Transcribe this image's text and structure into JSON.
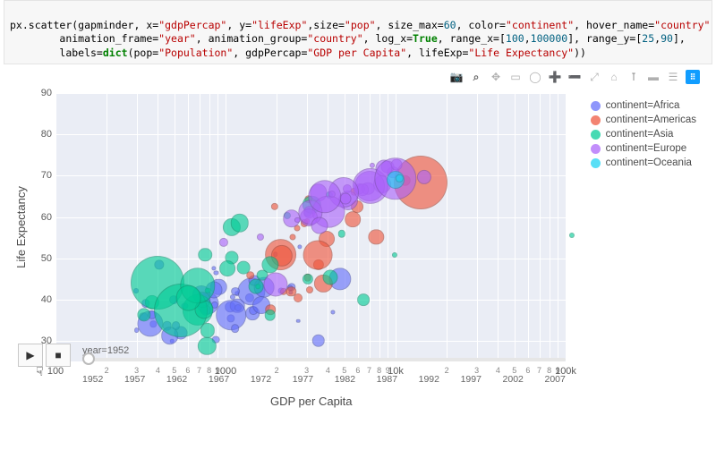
{
  "code": {
    "lines": [
      "px.scatter(gapminder, x=\"gdpPercap\", y=\"lifeExp\",size=\"pop\", size_max=60, color=\"continent\", hover_name=\"country\",",
      "        animation_frame=\"year\", animation_group=\"country\", log_x=True, range_x=[100,100000], range_y=[25,90],",
      "        labels=dict(pop=\"Population\", gdpPercap=\"GDP per Capita\", lifeExp=\"Life Expectancy\"))"
    ]
  },
  "toolbar": {
    "icons": [
      "camera-icon",
      "zoom-icon",
      "pan-icon",
      "box-select-icon",
      "lasso-icon",
      "zoom-in-icon",
      "zoom-out-icon",
      "autoscale-icon",
      "reset-icon",
      "spike-icon",
      "hover-icon",
      "hover-compare-icon",
      "plotly-logo"
    ]
  },
  "legend": {
    "items": [
      {
        "label": "continent=Africa",
        "color": "#636efa"
      },
      {
        "label": "continent=Americas",
        "color": "#ef553b"
      },
      {
        "label": "continent=Asia",
        "color": "#00cc96"
      },
      {
        "label": "continent=Europe",
        "color": "#ab63fa"
      },
      {
        "label": "continent=Oceania",
        "color": "#19d3f3"
      }
    ]
  },
  "axes": {
    "xlabel": "GDP per Capita",
    "ylabel": "Life Expectancy",
    "yticks": [
      "30",
      "40",
      "50",
      "60",
      "70",
      "80",
      "90"
    ],
    "xticks_major": [
      "100",
      "1000",
      "10k",
      "100k"
    ]
  },
  "animation": {
    "label": "year=1952",
    "play": "▶",
    "stop": "■",
    "years": [
      "1952",
      "1957",
      "1962",
      "1967",
      "1972",
      "1977",
      "1982",
      "1987",
      "1992",
      "1997",
      "2002",
      "2007"
    ]
  },
  "chart_data": {
    "type": "scatter",
    "title": "",
    "xlabel": "GDP per Capita",
    "ylabel": "Life Expectancy",
    "xlim": [
      100,
      100000
    ],
    "ylim": [
      25,
      90
    ],
    "log_x": true,
    "size_field": "pop",
    "size_max": 60,
    "animation_frame": "year",
    "current_frame": 1952,
    "series": [
      {
        "name": "Africa",
        "color": "#636efa",
        "points": [
          {
            "x": 2449,
            "y": 43.1,
            "size": 9.3
          },
          {
            "x": 3521,
            "y": 30.0,
            "size": 14.5
          },
          {
            "x": 1063,
            "y": 38.2,
            "size": 11.6
          },
          {
            "x": 851,
            "y": 47.6,
            "size": 5.2
          },
          {
            "x": 543,
            "y": 32.0,
            "size": 15.0
          },
          {
            "x": 339,
            "y": 39.0,
            "size": 9.6
          },
          {
            "x": 1173,
            "y": 38.5,
            "size": 16.6
          },
          {
            "x": 1071,
            "y": 35.5,
            "size": 9.2
          },
          {
            "x": 1179,
            "y": 38.1,
            "size": 8.1
          },
          {
            "x": 1103,
            "y": 40.7,
            "size": 6.1
          },
          {
            "x": 781,
            "y": 39.1,
            "size": 25.0
          },
          {
            "x": 2126,
            "y": 42.1,
            "size": 7.0
          },
          {
            "x": 1389,
            "y": 40.5,
            "size": 10.2
          },
          {
            "x": 2670,
            "y": 34.8,
            "size": 4.6
          },
          {
            "x": 1419,
            "y": 41.9,
            "size": 31.2
          },
          {
            "x": 376,
            "y": 34.1,
            "size": 7.5
          },
          {
            "x": 329,
            "y": 35.9,
            "size": 9.4
          },
          {
            "x": 362,
            "y": 34.1,
            "size": 29.2
          },
          {
            "x": 4293,
            "y": 37.0,
            "size": 5.1
          },
          {
            "x": 485,
            "y": 30.0,
            "size": 4.6
          },
          {
            "x": 912,
            "y": 43.1,
            "size": 18.5
          },
          {
            "x": 511,
            "y": 33.6,
            "size": 9.9
          },
          {
            "x": 300,
            "y": 32.5,
            "size": 5.8
          },
          {
            "x": 854,
            "y": 42.3,
            "size": 19.0
          },
          {
            "x": 299,
            "y": 42.1,
            "size": 5.9
          },
          {
            "x": 576,
            "y": 38.5,
            "size": 7.1
          },
          {
            "x": 2387,
            "y": 42.7,
            "size": 7.1
          },
          {
            "x": 1443,
            "y": 36.7,
            "size": 15.7
          },
          {
            "x": 369,
            "y": 36.3,
            "size": 10.4
          },
          {
            "x": 453,
            "y": 33.7,
            "size": 10.6
          },
          {
            "x": 744,
            "y": 40.5,
            "size": 8.0
          },
          {
            "x": 1968,
            "y": 51.0,
            "size": 5.5
          },
          {
            "x": 1688,
            "y": 42.9,
            "size": 22.8
          },
          {
            "x": 469,
            "y": 31.3,
            "size": 19.6
          },
          {
            "x": 2424,
            "y": 41.7,
            "size": 5.4
          },
          {
            "x": 762,
            "y": 37.4,
            "size": 12.4
          },
          {
            "x": 1077,
            "y": 36.3,
            "size": 33.6
          },
          {
            "x": 2719,
            "y": 52.7,
            "size": 5.2
          },
          {
            "x": 494,
            "y": 40.0,
            "size": 9.8
          },
          {
            "x": 880,
            "y": 46.5,
            "size": 5.1
          },
          {
            "x": 1451,
            "y": 37.3,
            "size": 9.8
          },
          {
            "x": 879,
            "y": 30.3,
            "size": 8.7
          },
          {
            "x": 1136,
            "y": 33.0,
            "size": 9.7
          },
          {
            "x": 4725,
            "y": 45.0,
            "size": 25.3
          },
          {
            "x": 1616,
            "y": 38.6,
            "size": 20.0
          },
          {
            "x": 1169,
            "y": 41.4,
            "size": 5.5
          },
          {
            "x": 717,
            "y": 41.2,
            "size": 20.1
          },
          {
            "x": 860,
            "y": 38.6,
            "size": 8.2
          },
          {
            "x": 1468,
            "y": 44.6,
            "size": 12.9
          },
          {
            "x": 735,
            "y": 40.0,
            "size": 17.7
          },
          {
            "x": 1147,
            "y": 42.0,
            "size": 9.8
          },
          {
            "x": 407,
            "y": 48.5,
            "size": 11.3
          }
        ]
      },
      {
        "name": "Americas",
        "color": "#ef553b",
        "points": [
          {
            "x": 5911,
            "y": 62.5,
            "size": 13.9
          },
          {
            "x": 2677,
            "y": 40.4,
            "size": 10.0
          },
          {
            "x": 2109,
            "y": 50.9,
            "size": 35.8
          },
          {
            "x": 11367,
            "y": 68.8,
            "size": 12.5
          },
          {
            "x": 3940,
            "y": 54.7,
            "size": 17.9
          },
          {
            "x": 2144,
            "y": 50.6,
            "size": 24.3
          },
          {
            "x": 2627,
            "y": 57.2,
            "size": 7.0
          },
          {
            "x": 5587,
            "y": 59.4,
            "size": 17.7
          },
          {
            "x": 1398,
            "y": 45.9,
            "size": 9.6
          },
          {
            "x": 3522,
            "y": 48.4,
            "size": 12.2
          },
          {
            "x": 3048,
            "y": 45.3,
            "size": 8.5
          },
          {
            "x": 2428,
            "y": 42.0,
            "size": 11.4
          },
          {
            "x": 1840,
            "y": 37.6,
            "size": 11.6
          },
          {
            "x": 2195,
            "y": 41.9,
            "size": 8.3
          },
          {
            "x": 2899,
            "y": 58.5,
            "size": 8.1
          },
          {
            "x": 3478,
            "y": 50.8,
            "size": 32.9
          },
          {
            "x": 3112,
            "y": 42.3,
            "size": 8.0
          },
          {
            "x": 2480,
            "y": 55.2,
            "size": 7.0
          },
          {
            "x": 1952,
            "y": 62.6,
            "size": 8.3
          },
          {
            "x": 3759,
            "y": 43.9,
            "size": 20.3
          },
          {
            "x": 3082,
            "y": 64.3,
            "size": 9.5
          },
          {
            "x": 3023,
            "y": 59.1,
            "size": 5.9
          },
          {
            "x": 13990,
            "y": 68.4,
            "size": 60.0
          },
          {
            "x": 5717,
            "y": 66.1,
            "size": 8.5
          },
          {
            "x": 7690,
            "y": 55.1,
            "size": 17.3
          }
        ]
      },
      {
        "name": "Asia",
        "color": "#00cc96",
        "points": [
          {
            "x": 779,
            "y": 28.8,
            "size": 20.4
          },
          {
            "x": 9867,
            "y": 50.9,
            "size": 6.1
          },
          {
            "x": 684,
            "y": 37.5,
            "size": 34.2
          },
          {
            "x": 368,
            "y": 39.4,
            "size": 16.3
          },
          {
            "x": 400,
            "y": 44.0,
            "size": 60.0
          },
          {
            "x": 3054,
            "y": 61.0,
            "size": 9.3
          },
          {
            "x": 547,
            "y": 37.4,
            "size": 60.0
          },
          {
            "x": 750,
            "y": 37.5,
            "size": 21.1
          },
          {
            "x": 3035,
            "y": 44.9,
            "size": 12.2
          },
          {
            "x": 4129,
            "y": 45.3,
            "size": 17.0
          },
          {
            "x": 4086,
            "y": 65.4,
            "size": 8.2
          },
          {
            "x": 3217,
            "y": 63.0,
            "size": 20.4
          },
          {
            "x": 1547,
            "y": 43.2,
            "size": 5.6
          },
          {
            "x": 1088,
            "y": 50.1,
            "size": 15.1
          },
          {
            "x": 1030,
            "y": 47.5,
            "size": 17.8
          },
          {
            "x": 108382,
            "y": 55.6,
            "size": 6.1
          },
          {
            "x": 4835,
            "y": 55.9,
            "size": 8.4
          },
          {
            "x": 1832,
            "y": 48.5,
            "size": 19.2
          },
          {
            "x": 787,
            "y": 42.2,
            "size": 6.6
          },
          {
            "x": 331,
            "y": 36.3,
            "size": 15.3
          },
          {
            "x": 1828,
            "y": 36.2,
            "size": 12.6
          },
          {
            "x": 684,
            "y": 43.4,
            "size": 39.4
          },
          {
            "x": 1273,
            "y": 47.8,
            "size": 14.8
          },
          {
            "x": 6460,
            "y": 39.9,
            "size": 13.8
          },
          {
            "x": 2315,
            "y": 60.4,
            "size": 8.1
          },
          {
            "x": 1084,
            "y": 57.6,
            "size": 20.2
          },
          {
            "x": 1643,
            "y": 45.9,
            "size": 12.8
          },
          {
            "x": 757,
            "y": 50.8,
            "size": 15.5
          },
          {
            "x": 1207,
            "y": 58.5,
            "size": 20.5
          },
          {
            "x": 605,
            "y": 40.4,
            "size": 28.8
          },
          {
            "x": 1515,
            "y": 43.2,
            "size": 16.8
          },
          {
            "x": 782,
            "y": 32.5,
            "size": 16.3
          }
        ]
      },
      {
        "name": "Europe",
        "color": "#ab63fa",
        "points": [
          {
            "x": 1601,
            "y": 55.2,
            "size": 8.1
          },
          {
            "x": 6137,
            "y": 66.8,
            "size": 12.1
          },
          {
            "x": 8343,
            "y": 68.0,
            "size": 20.0
          },
          {
            "x": 974,
            "y": 53.8,
            "size": 10.2
          },
          {
            "x": 2444,
            "y": 59.6,
            "size": 19.5
          },
          {
            "x": 3119,
            "y": 61.2,
            "size": 13.6
          },
          {
            "x": 6876,
            "y": 66.9,
            "size": 14.6
          },
          {
            "x": 9692,
            "y": 70.8,
            "size": 13.7
          },
          {
            "x": 6425,
            "y": 66.6,
            "size": 13.7
          },
          {
            "x": 7029,
            "y": 67.4,
            "size": 33.9
          },
          {
            "x": 7144,
            "y": 67.5,
            "size": 40.2
          },
          {
            "x": 3531,
            "y": 65.9,
            "size": 19.4
          },
          {
            "x": 5264,
            "y": 64.0,
            "size": 22.0
          },
          {
            "x": 7268,
            "y": 72.5,
            "size": 6.2
          },
          {
            "x": 5210,
            "y": 66.9,
            "size": 10.0
          },
          {
            "x": 4931,
            "y": 65.9,
            "size": 34.0
          },
          {
            "x": 2648,
            "y": 59.2,
            "size": 6.2
          },
          {
            "x": 8942,
            "y": 72.1,
            "size": 14.8
          },
          {
            "x": 10095,
            "y": 72.7,
            "size": 12.8
          },
          {
            "x": 4029,
            "y": 61.3,
            "size": 36.8
          },
          {
            "x": 3069,
            "y": 59.8,
            "size": 20.0
          },
          {
            "x": 3145,
            "y": 61.1,
            "size": 27.3
          },
          {
            "x": 3581,
            "y": 58.0,
            "size": 18.9
          },
          {
            "x": 5075,
            "y": 64.4,
            "size": 12.9
          },
          {
            "x": 4215,
            "y": 65.6,
            "size": 8.1
          },
          {
            "x": 3834,
            "y": 64.9,
            "size": 37.4
          },
          {
            "x": 8528,
            "y": 71.9,
            "size": 19.0
          },
          {
            "x": 14734,
            "y": 69.6,
            "size": 16.2
          },
          {
            "x": 1970,
            "y": 43.6,
            "size": 27.1
          },
          {
            "x": 9980,
            "y": 69.2,
            "size": 47.4
          }
        ]
      },
      {
        "name": "Oceania",
        "color": "#19d3f3",
        "points": [
          {
            "x": 10040,
            "y": 69.1,
            "size": 20.0
          },
          {
            "x": 10557,
            "y": 69.4,
            "size": 8.4
          }
        ]
      }
    ]
  }
}
